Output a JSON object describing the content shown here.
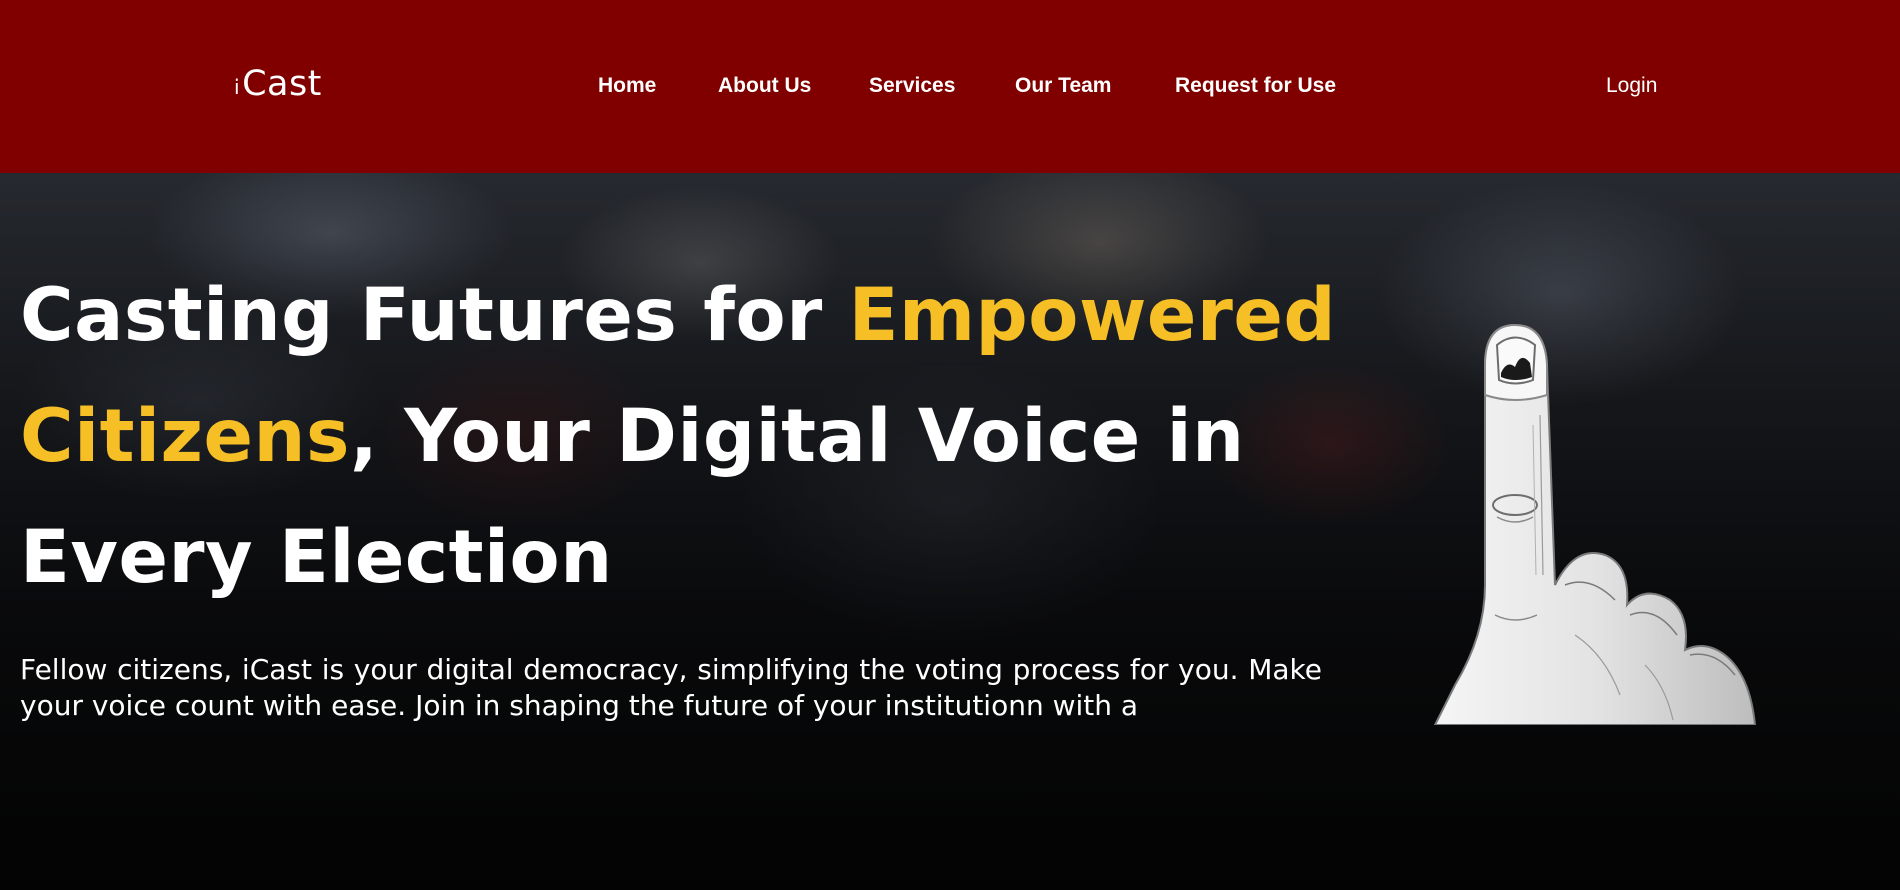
{
  "navbar": {
    "logo_text": "Cast",
    "logo_mark": "i",
    "links": [
      "Home",
      "About Us",
      "Services",
      "Our Team",
      "Request for Use"
    ],
    "login_label": "Login",
    "background_color": "#800000"
  },
  "hero": {
    "headline": {
      "part1": "Casting Futures for ",
      "accent1": "Empowered",
      "accent2": "Citizens",
      "part2": ", Your Digital Voice in Every Election"
    },
    "description": "Fellow citizens, iCast is your digital democracy, simplifying the voting process for you. Make your voice count with ease. Join in shaping the future of your institutionn with a",
    "accent_color": "#f6bf26",
    "image_alt": "inked-finger-illustration"
  }
}
